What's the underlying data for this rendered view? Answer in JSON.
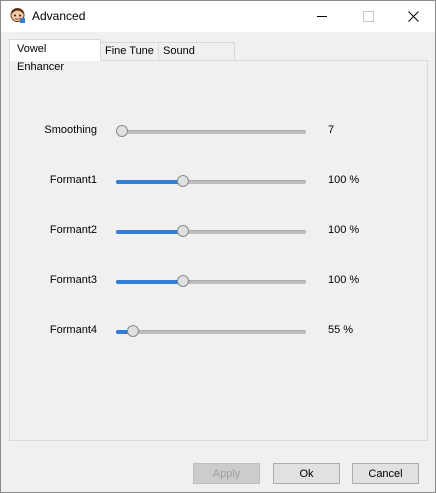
{
  "window": {
    "title": "Advanced"
  },
  "tabs": [
    {
      "label": "Vowel Enhancer",
      "active": true
    },
    {
      "label": "Fine Tune",
      "active": false
    },
    {
      "label": "Sound Quality",
      "active": false
    }
  ],
  "sliders": [
    {
      "label": "Smoothing",
      "value_text": "7",
      "level": 0.0
    },
    {
      "label": "Formant1",
      "value_text": "100 %",
      "level": 0.34
    },
    {
      "label": "Formant2",
      "value_text": "100 %",
      "level": 0.34
    },
    {
      "label": "Formant3",
      "value_text": "100 %",
      "level": 0.34
    },
    {
      "label": "Formant4",
      "value_text": "55 %",
      "level": 0.06
    }
  ],
  "buttons": {
    "apply": "Apply",
    "ok": "Ok",
    "cancel": "Cancel"
  },
  "colors": {
    "accent": "#2f7fd6",
    "track": "#bdbdbd",
    "panel": "#f0f0f0"
  }
}
